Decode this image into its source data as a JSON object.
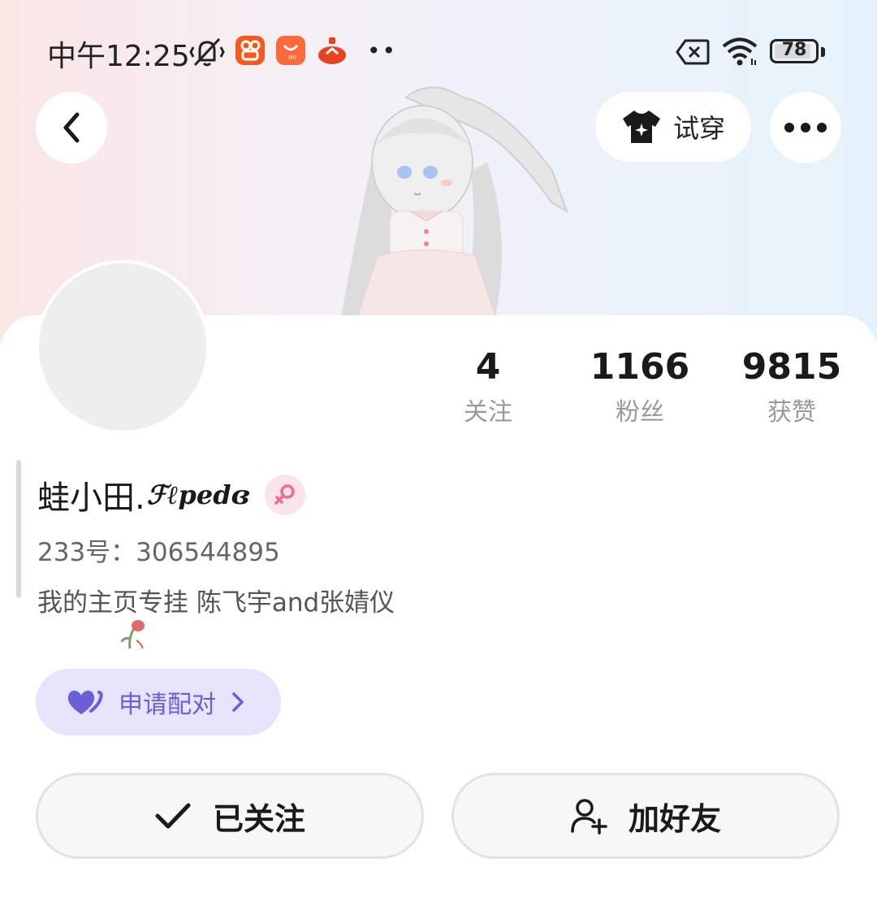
{
  "status_bar": {
    "time": "中午12:25",
    "battery": "78",
    "icons": [
      "mute-icon",
      "kuaishou-icon",
      "mi-store-icon",
      "app-icon",
      "sim-off-icon",
      "wifi-icon",
      "battery-icon"
    ]
  },
  "header": {
    "try_on_label": "试穿"
  },
  "stats": [
    {
      "value": "4",
      "label": "关注"
    },
    {
      "value": "1166",
      "label": "粉丝"
    },
    {
      "value": "9815",
      "label": "获赞"
    }
  ],
  "profile": {
    "name": "蛙小田.",
    "name_script": "ℱℓpedɞ",
    "uid": "233号：306544895",
    "bio": "我的主页专挂 陈飞宇and张婧仪",
    "gender": "female"
  },
  "pair_button": {
    "label": "申请配对"
  },
  "actions": {
    "follow_label": "已关注",
    "add_friend_label": "加好友"
  },
  "colors": {
    "accent": "#6a5fd6",
    "pair_bg": "#e6e3fb",
    "gender_pink": "#f06a93"
  }
}
